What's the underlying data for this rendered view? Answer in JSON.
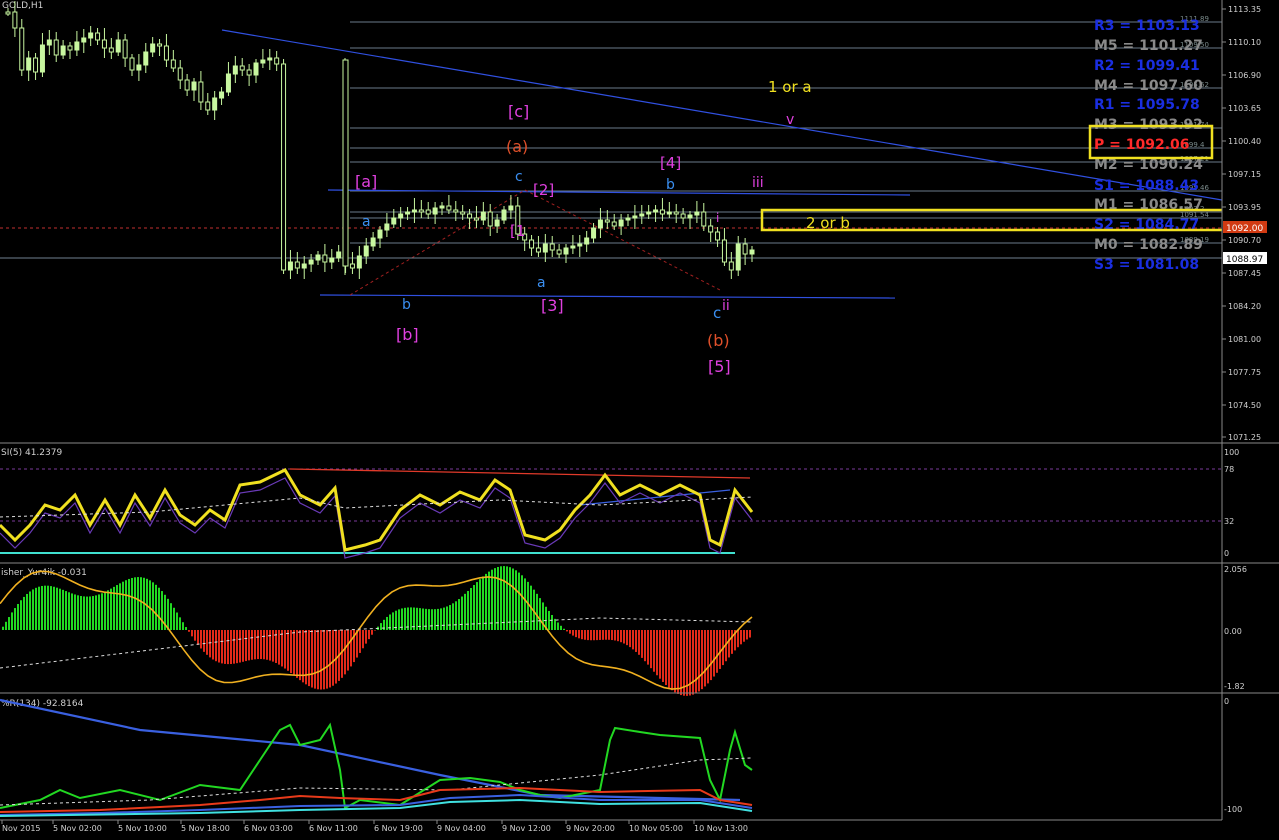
{
  "window": {
    "symbol_caption": "GOLD,H1"
  },
  "price_axis": {
    "labels": [
      "1113.35",
      "1110.10",
      "1106.90",
      "1103.65",
      "1100.40",
      "1097.15",
      "1093.95",
      "1090.70",
      "1087.45",
      "1084.20",
      "1081.00",
      "1077.75",
      "1074.50",
      "1071.25"
    ],
    "current_price_label": "1088.97",
    "red_line_label": "1092.00"
  },
  "pivots": [
    {
      "label": "R3 = 1103.13",
      "color": "#1a2ee0"
    },
    {
      "label": "M5 = 1101.27",
      "color": "#8a8a8a"
    },
    {
      "label": "R2 = 1099.41",
      "color": "#1a2ee0"
    },
    {
      "label": "M4 = 1097.60",
      "color": "#8a8a8a"
    },
    {
      "label": "R1 = 1095.78",
      "color": "#1a2ee0"
    },
    {
      "label": "M3 = 1093.92",
      "color": "#8a8a8a"
    },
    {
      "label": "P  = 1092.06",
      "color": "#ff2a2a"
    },
    {
      "label": "M2 = 1090.24",
      "color": "#8a8a8a"
    },
    {
      "label": "S1 = 1088.43",
      "color": "#1a2ee0"
    },
    {
      "label": "M1 = 1086.57",
      "color": "#8a8a8a"
    },
    {
      "label": "S2 = 1084.77",
      "color": "#1a2ee0"
    },
    {
      "label": "M0 = 1082.89",
      "color": "#8a8a8a"
    },
    {
      "label": "S3 = 1081.08",
      "color": "#1a2ee0"
    }
  ],
  "fib_line_labels": [
    "1111.89",
    "1109.50",
    "1105.62",
    "1101.74",
    "1099.4",
    "1097.21",
    "1095.46",
    "1093.2",
    "1091.54",
    "1089.19"
  ],
  "wave_labels": [
    {
      "text": "[c]",
      "color": "#e040e0"
    },
    {
      "text": "(a)",
      "color": "#e0502a"
    },
    {
      "text": "[a]",
      "color": "#e040e0"
    },
    {
      "text": "a",
      "color": "#3a8ef0"
    },
    {
      "text": "c",
      "color": "#3a8ef0"
    },
    {
      "text": "[2]",
      "color": "#e040e0"
    },
    {
      "text": "[1",
      "color": "#e040e0"
    },
    {
      "text": "[4]",
      "color": "#e040e0"
    },
    {
      "text": "b",
      "color": "#3a8ef0"
    },
    {
      "text": "iii",
      "color": "#e040e0"
    },
    {
      "text": "1 or a",
      "color": "#f0e020"
    },
    {
      "text": "v",
      "color": "#e040e0"
    },
    {
      "text": "2 or b",
      "color": "#f0e020"
    },
    {
      "text": "a",
      "color": "#3a8ef0"
    },
    {
      "text": "[3]",
      "color": "#e040e0"
    },
    {
      "text": "b",
      "color": "#3a8ef0"
    },
    {
      "text": "[b]",
      "color": "#e040e0"
    },
    {
      "text": "c",
      "color": "#3a8ef0"
    },
    {
      "text": "ii",
      "color": "#e040e0"
    },
    {
      "text": "(b)",
      "color": "#e0502a"
    },
    {
      "text": "[5]",
      "color": "#e040e0"
    },
    {
      "text": "i",
      "color": "#e040e0"
    }
  ],
  "rsi_panel": {
    "caption": "SI(5) 41.2379",
    "levels": [
      "100",
      "78",
      "32",
      "0"
    ]
  },
  "fisher_panel": {
    "caption": "isher_Yur4ik -0.031",
    "levels": [
      "2.056",
      "0.00",
      "-1.82"
    ]
  },
  "wpr_panel": {
    "caption": "%R(134) -92.8164",
    "levels": [
      "0",
      "-100"
    ]
  },
  "time_axis": [
    "Nov 2015",
    "5 Nov 02:00",
    "5 Nov 10:00",
    "5 Nov 18:00",
    "6 Nov 03:00",
    "6 Nov 11:00",
    "6 Nov 19:00",
    "9 Nov 04:00",
    "9 Nov 12:00",
    "9 Nov 20:00",
    "10 Nov 05:00",
    "10 Nov 13:00"
  ],
  "colors": {
    "background": "#000000",
    "candle": "#c8f7a0",
    "axis_text": "#d0d0d0",
    "rsi": "#f0e020",
    "fisher_up": "#22d822",
    "fisher_down": "#e22a1a",
    "highlight_box": "#f0e020"
  }
}
